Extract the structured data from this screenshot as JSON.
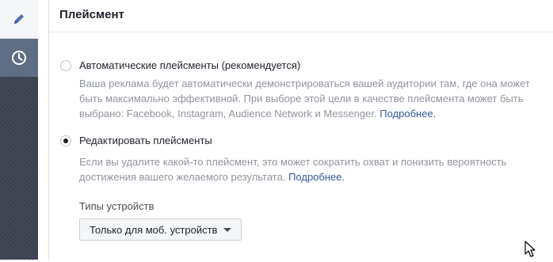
{
  "rail": {
    "items": [
      {
        "icon": "pencil-icon",
        "active": true
      },
      {
        "icon": "clock-icon",
        "active": false
      }
    ]
  },
  "header": {
    "title": "Плейсмент"
  },
  "options": [
    {
      "label": "Автоматические плейсменты (рекомендуется)",
      "selected": false,
      "description_line1": "Ваша реклама будет автоматически демонстрироваться вашей аудитории там, где она может",
      "description_line2": "быть максимально эффективной. При выборе этой цели в качестве плейсмента может быть",
      "description_line3": "выбрано: Facebook, Instagram, Audience Network и Messenger.",
      "link": "Подробнее."
    },
    {
      "label": "Редактировать плейсменты",
      "selected": true,
      "description_line1": "Если вы удалите какой-то плейсмент, это может сократить охват и понизить вероятность",
      "description_line2": "достижения вашего желаемого результата.",
      "link": "Подробнее."
    }
  ],
  "device_types": {
    "label": "Типы устройств",
    "selected": "Только для моб. устройств"
  },
  "colors": {
    "link": "#365899",
    "muted_text": "#90949c",
    "rail": "#3d4451",
    "rail_active": "#5f6e85"
  }
}
